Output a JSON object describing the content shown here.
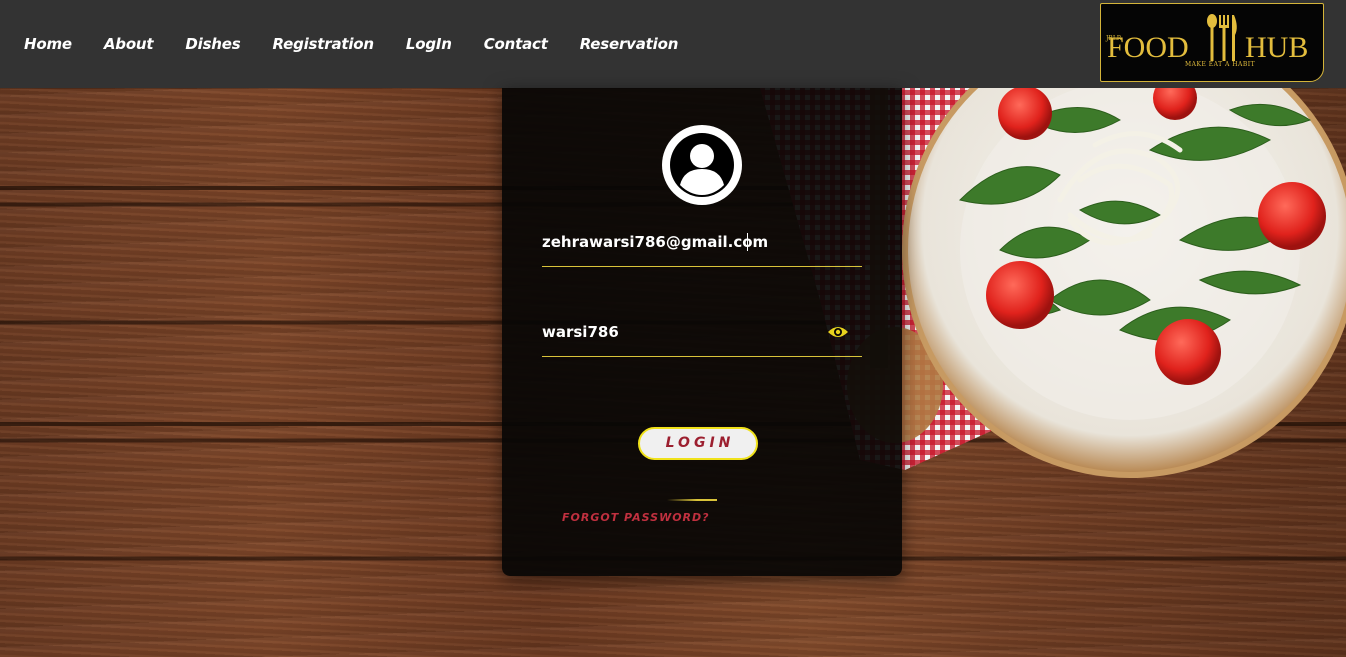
{
  "nav": {
    "items": [
      {
        "label": "Home"
      },
      {
        "label": "About"
      },
      {
        "label": "Dishes"
      },
      {
        "label": "Registration"
      },
      {
        "label": "LogIn"
      },
      {
        "label": "Contact"
      },
      {
        "label": "Reservation"
      }
    ]
  },
  "logo": {
    "small_text": "JBLR",
    "word1": "FOOD",
    "word2": "HUB",
    "tagline": "MAKE EAT A HABIT"
  },
  "login": {
    "avatar_icon": "user-circle-icon",
    "email_value": "zehrawarsi786@gmail.com",
    "password_value": "warsi786",
    "eye_icon": "eye-icon",
    "button_label": "LOGIN",
    "forgot_label": "FORGOT PASSWORD?"
  },
  "colors": {
    "navbar": "#333333",
    "accent_yellow": "#d9c33a",
    "button_text": "#9c1f2f",
    "forgot_text": "#c0303f",
    "card_bg": "#080605"
  }
}
